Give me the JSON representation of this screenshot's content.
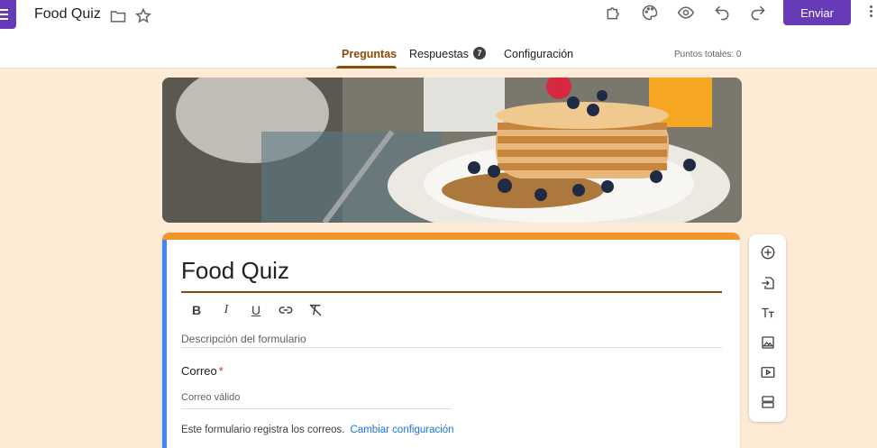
{
  "app": {
    "title": "Food Quiz"
  },
  "toolbar": {
    "send_label": "Enviar"
  },
  "tabs": [
    {
      "label": "Preguntas"
    },
    {
      "label": "Respuestas",
      "badge": "7"
    },
    {
      "label": "Configuración"
    }
  ],
  "points_label": "Puntos totales: 0",
  "form": {
    "title": "Food Quiz",
    "description_placeholder": "Descripción del formulario",
    "email_label": "Correo",
    "required_mark": "*",
    "email_placeholder": "Correo válido",
    "email_note": "Este formulario registra los correos.",
    "change_settings": "Cambiar configuración"
  },
  "format_buttons": [
    {
      "label": "B",
      "icon": "bold-icon"
    },
    {
      "label": "I",
      "icon": "italic-icon"
    },
    {
      "label": "U",
      "icon": "underline-icon"
    }
  ],
  "icons": [
    "folder-icon",
    "star-icon",
    "addons-icon",
    "palette-icon",
    "preview-icon",
    "undo-icon",
    "redo-icon",
    "more-icon",
    "link-icon",
    "clear-format-icon",
    "add-question-icon",
    "import-question-icon",
    "add-title-icon",
    "add-image-icon",
    "add-video-icon",
    "add-section-icon"
  ],
  "colors": {
    "accent": "#673ab7",
    "theme": "#8a4b08",
    "header_bar": "#f0962e",
    "background": "#fdebd6"
  }
}
